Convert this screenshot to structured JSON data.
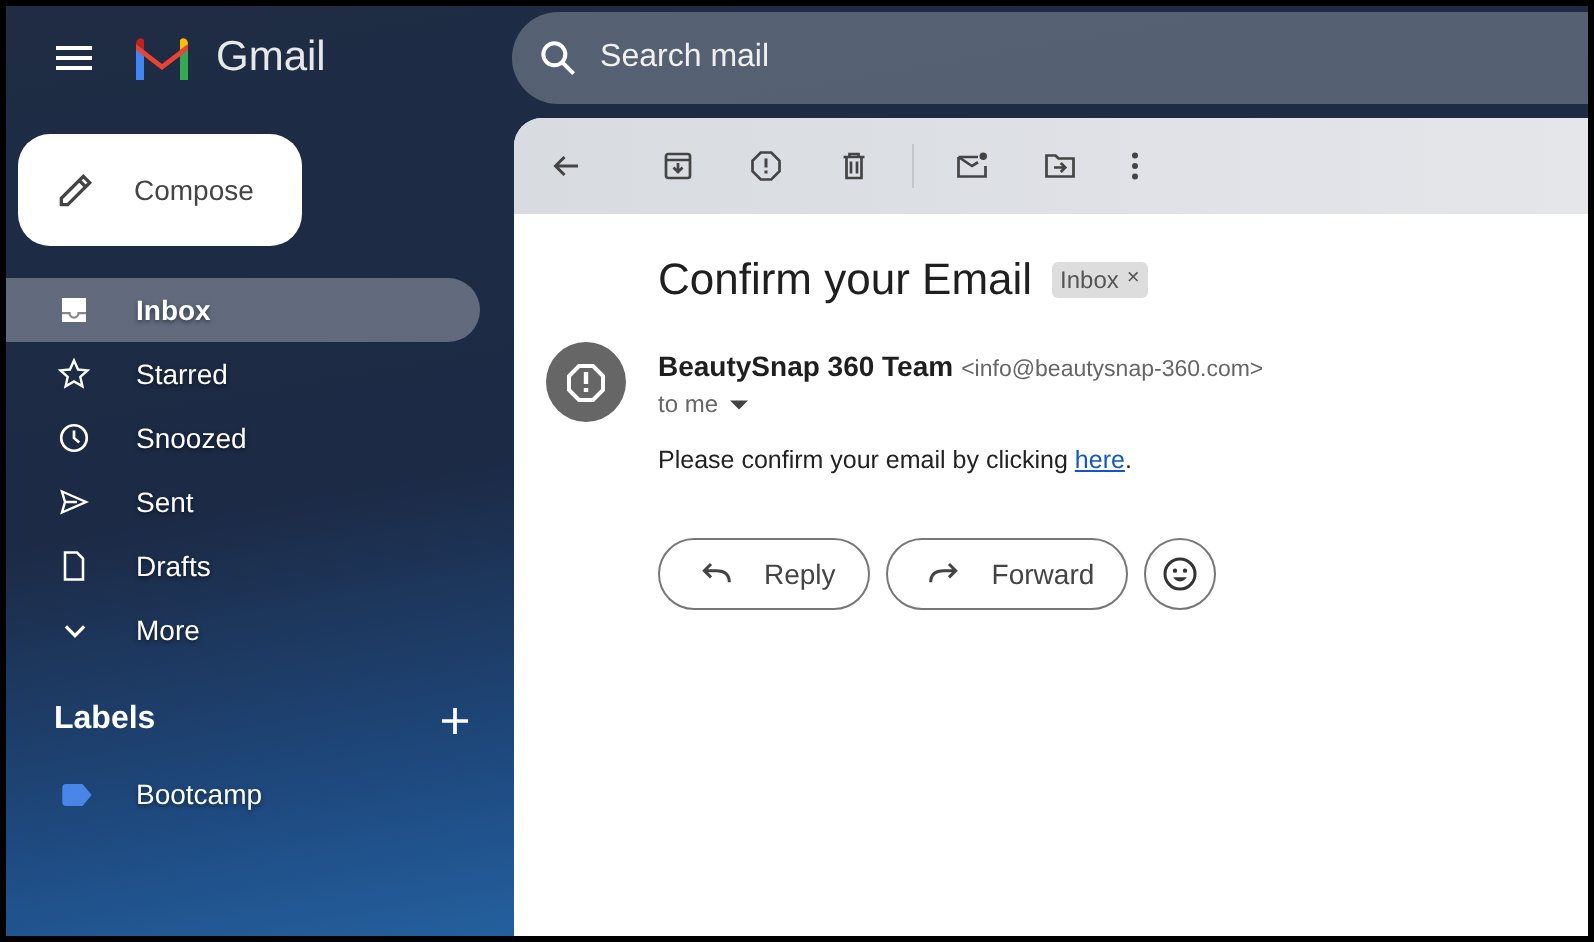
{
  "app": {
    "name": "Gmail"
  },
  "search": {
    "placeholder": "Search mail"
  },
  "compose": {
    "label": "Compose"
  },
  "nav": [
    {
      "label": "Inbox",
      "kind": "inbox",
      "selected": true
    },
    {
      "label": "Starred",
      "kind": "starred",
      "selected": false
    },
    {
      "label": "Snoozed",
      "kind": "snoozed",
      "selected": false
    },
    {
      "label": "Sent",
      "kind": "sent",
      "selected": false
    },
    {
      "label": "Drafts",
      "kind": "drafts",
      "selected": false
    },
    {
      "label": "More",
      "kind": "more",
      "selected": false
    }
  ],
  "labels": {
    "title": "Labels",
    "items": [
      {
        "label": "Bootcamp",
        "color": "#4a86e8"
      }
    ]
  },
  "message": {
    "subject": "Confirm your Email",
    "tag": "Inbox",
    "tag_close": "×",
    "sender_name": "BeautySnap 360 Team",
    "sender_email": "<info@beautysnap-360.com>",
    "recipient": "to me",
    "body_before": "Please confirm your email by clicking ",
    "body_link": "here",
    "body_after": "."
  },
  "actions": [
    {
      "kind": "reply",
      "label": "Reply"
    },
    {
      "kind": "forward",
      "label": "Forward"
    },
    {
      "kind": "emoji"
    }
  ]
}
